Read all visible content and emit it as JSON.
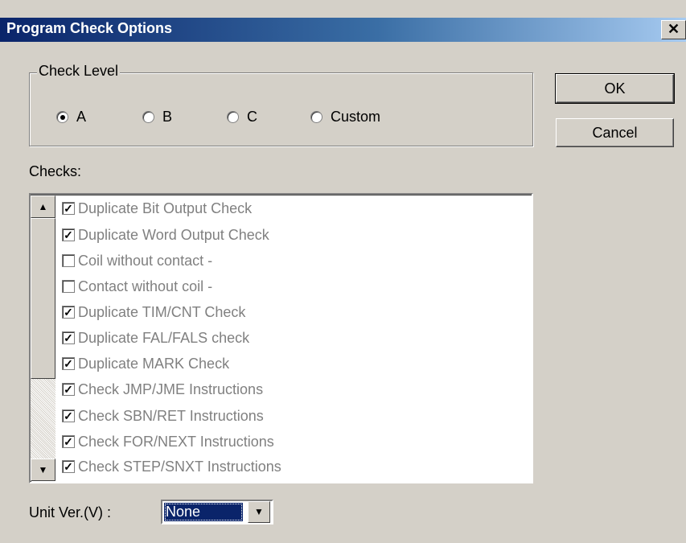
{
  "window": {
    "title": "Program Check Options",
    "close_symbol": "✕"
  },
  "check_level": {
    "legend": "Check Level",
    "options": [
      {
        "label": "A",
        "checked": true
      },
      {
        "label": "B",
        "checked": false
      },
      {
        "label": "C",
        "checked": false
      },
      {
        "label": "Custom",
        "checked": false
      }
    ]
  },
  "buttons": {
    "ok": "OK",
    "cancel": "Cancel"
  },
  "checks": {
    "label": "Checks:",
    "items": [
      {
        "label": "Duplicate Bit Output Check",
        "checked": true
      },
      {
        "label": "Duplicate Word Output Check",
        "checked": true
      },
      {
        "label": "Coil without contact -",
        "checked": false
      },
      {
        "label": "Contact without coil -",
        "checked": false
      },
      {
        "label": "Duplicate TIM/CNT Check",
        "checked": true
      },
      {
        "label": "Duplicate FAL/FALS check",
        "checked": true
      },
      {
        "label": "Duplicate MARK Check",
        "checked": true
      },
      {
        "label": "Check JMP/JME Instructions",
        "checked": true
      },
      {
        "label": "Check SBN/RET Instructions",
        "checked": true
      },
      {
        "label": "Check FOR/NEXT Instructions",
        "checked": true
      },
      {
        "label": "Check STEP/SNXT Instructions",
        "checked": true
      }
    ],
    "scroll_up_symbol": "▲",
    "scroll_down_symbol": "▼"
  },
  "unit_version": {
    "label": "Unit Ver.(V) :",
    "value": "None",
    "arrow_symbol": "▼"
  }
}
